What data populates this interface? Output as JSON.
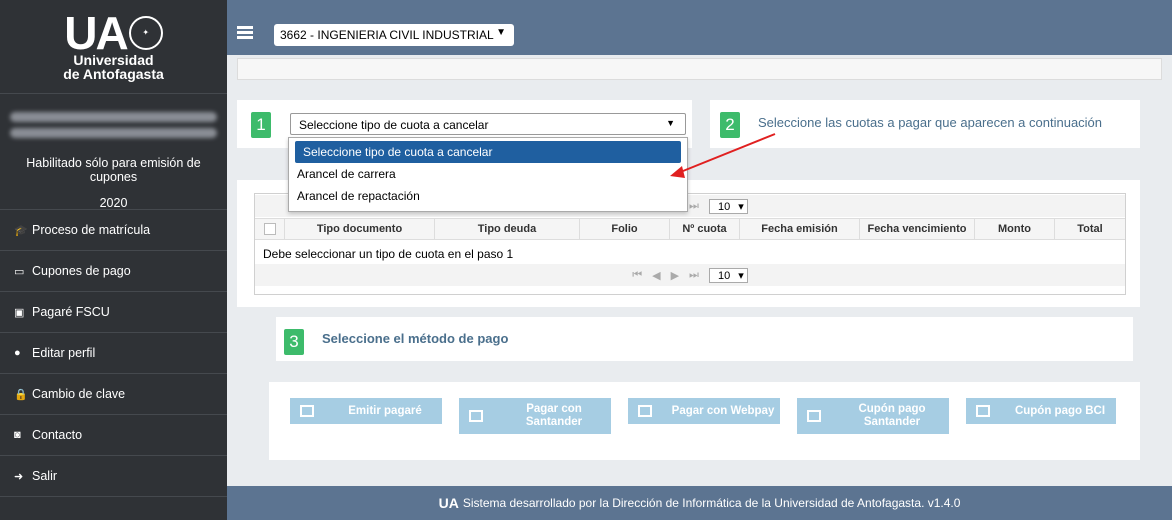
{
  "sidebar": {
    "logo": {
      "ua": "UA",
      "line1": "Universidad",
      "line2": "de Antofagasta"
    },
    "user": {
      "note": "Habilitado sólo para emisión de cupones",
      "year": "2020"
    },
    "items": [
      {
        "icon": "graduation-cap-icon",
        "label": "Proceso de matrícula"
      },
      {
        "icon": "credit-card-icon",
        "label": "Cupones de pago"
      },
      {
        "icon": "pdf-file-icon",
        "label": "Pagaré FSCU"
      },
      {
        "icon": "user-icon",
        "label": "Editar perfil"
      },
      {
        "icon": "lock-icon",
        "label": "Cambio de clave"
      },
      {
        "icon": "contact-icon",
        "label": "Contacto"
      },
      {
        "icon": "sign-out-icon",
        "label": "Salir"
      }
    ]
  },
  "topbar": {
    "career": "3662 - INGENIERIA CIVIL INDUSTRIAL"
  },
  "step1": {
    "num": "1",
    "select_value": "Seleccione tipo de cuota a cancelar",
    "options": [
      "Seleccione tipo de cuota a cancelar",
      "Arancel de carrera",
      "Arancel de repactación"
    ]
  },
  "step2": {
    "num": "2",
    "text": "Seleccione las cuotas a pagar que aparecen a continuación"
  },
  "grid": {
    "page_size": "10",
    "columns": [
      "Tipo documento",
      "Tipo deuda",
      "Folio",
      "Nº cuota",
      "Fecha emisión",
      "Fecha vencimiento",
      "Monto",
      "Total"
    ],
    "empty_message": "Debe seleccionar un tipo de cuota en el paso 1"
  },
  "step3": {
    "num": "3",
    "text": "Seleccione el método de pago"
  },
  "payment": {
    "emitir": "Emitir pagaré",
    "santander_l1": "Pagar con",
    "santander_l2": "Santander",
    "webpay": "Pagar con Webpay",
    "cupon_sant_l1": "Cupón pago",
    "cupon_sant_l2": "Santander",
    "cupon_bci": "Cupón pago BCI"
  },
  "footer": {
    "logo": "UA",
    "text": "Sistema desarrollado por la Dirección de Informática de la Universidad de Antofagasta. v1.4.0"
  },
  "colors": {
    "sidebar": "#2f3236",
    "topbar": "#5c7491",
    "step_green": "#3dbb6b",
    "button": "#a6cde3",
    "selected_option": "#1f5fa0"
  }
}
